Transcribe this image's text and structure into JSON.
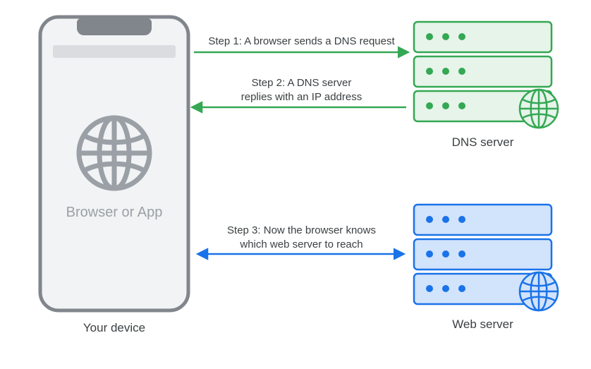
{
  "device": {
    "label": "Your device",
    "app_label": "Browser or App"
  },
  "dns_server": {
    "label": "DNS server"
  },
  "web_server": {
    "label": "Web server"
  },
  "steps": {
    "s1": "Step 1: A browser sends a DNS request",
    "s2": "Step 2: A DNS server\nreplies with an IP address",
    "s3": "Step 3: Now the browser knows\nwhich web server to reach"
  },
  "colors": {
    "green": "#34a853",
    "green_fill": "#e6f4ea",
    "blue": "#1a73e8",
    "blue_fill": "#d2e3fc",
    "grey_stroke": "#80868b",
    "grey_fill": "#f1f3f4",
    "grey_icon": "#9aa0a6"
  },
  "chart_data": {
    "type": "diagram",
    "nodes": [
      {
        "id": "device",
        "label": "Your device",
        "sublabel": "Browser or App"
      },
      {
        "id": "dns",
        "label": "DNS server"
      },
      {
        "id": "web",
        "label": "Web server"
      }
    ],
    "edges": [
      {
        "from": "device",
        "to": "dns",
        "label": "Step 1: A browser sends a DNS request",
        "direction": "forward"
      },
      {
        "from": "dns",
        "to": "device",
        "label": "Step 2: A DNS server replies with an IP address",
        "direction": "forward"
      },
      {
        "from": "device",
        "to": "web",
        "label": "Step 3: Now the browser knows which web server to reach",
        "direction": "both"
      }
    ]
  }
}
